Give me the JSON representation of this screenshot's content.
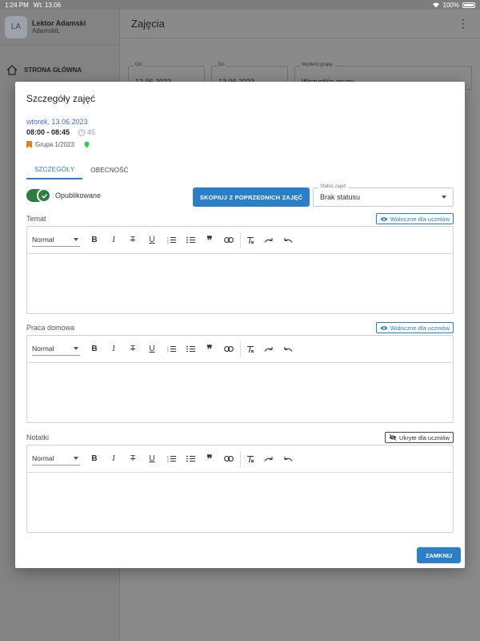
{
  "statusbar": {
    "time": "1:24 PM",
    "date": "Wt. 13.06",
    "battery": "100%"
  },
  "user": {
    "initials": "LA",
    "name": "Lektor Adamski",
    "login": "AdamskiL"
  },
  "nav": {
    "home_label": "STRONA GŁÓWNA"
  },
  "header": {
    "title": "Zajęcia"
  },
  "filters": {
    "from_label": "Od",
    "from_value": "13.06.2023",
    "to_label": "Do",
    "to_value": "13.06.2023",
    "group_label": "Wybierz grupę",
    "group_value": "Wszystkie grupy"
  },
  "modal": {
    "title": "Szczegóły zajęć",
    "date": "wtorek, 13.06.2023",
    "time": "08:00 - 08:45",
    "duration": "45",
    "group": "Grupa 1/2023",
    "tabs": [
      {
        "label": "SZCZEGÓŁY"
      },
      {
        "label": "OBECNOŚĆ"
      }
    ],
    "published_label": "Opublikowane",
    "copy_button": "SKOPIUJ Z POPRZEDNICH ZAJĘĆ",
    "status_label": "Status zajęć",
    "status_value": "Brak statusu",
    "sections": [
      {
        "label": "Temat",
        "visibility": "Widoczne dla uczniów"
      },
      {
        "label": "Praca domowa",
        "visibility": "Widoczne dla uczniów"
      },
      {
        "label": "Notatki",
        "visibility": "Ukryte dla uczniów"
      }
    ],
    "format_value": "Normal",
    "close_button": "ZAMKNIJ"
  },
  "colors": {
    "accent": "#2a7fc8",
    "switch_on": "#2f7d40",
    "date_link": "#3f6fd6",
    "bookmark": "#f07b1f",
    "pin": "#2ecc40"
  }
}
